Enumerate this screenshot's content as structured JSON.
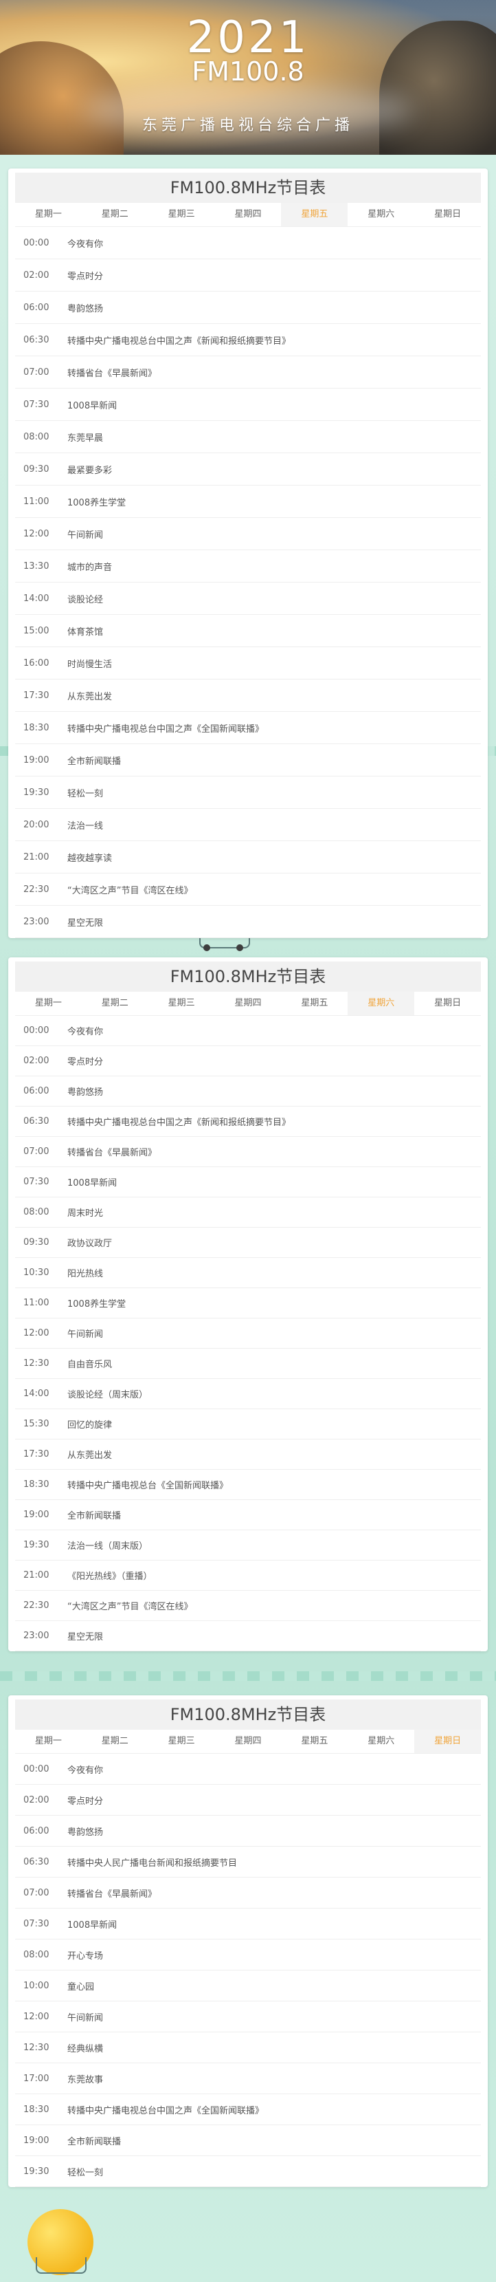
{
  "header": {
    "year": "2021",
    "frequency": "FM100.8",
    "station": "东莞广播电视台综合广播"
  },
  "schedules": [
    {
      "title": "FM100.8MHz节目表",
      "days": [
        "星期一",
        "星期二",
        "星期三",
        "星期四",
        "星期五",
        "星期六",
        "星期日"
      ],
      "active_day": 4,
      "rows": [
        {
          "time": "00:00",
          "name": "今夜有你"
        },
        {
          "time": "02:00",
          "name": "零点时分"
        },
        {
          "time": "06:00",
          "name": "粤韵悠扬"
        },
        {
          "time": "06:30",
          "name": "转播中央广播电视总台中国之声《新闻和报纸摘要节目》"
        },
        {
          "time": "07:00",
          "name": "转播省台《早晨新闻》"
        },
        {
          "time": "07:30",
          "name": "1008早新闻"
        },
        {
          "time": "08:00",
          "name": "东莞早晨"
        },
        {
          "time": "09:30",
          "name": "最紧要多彩"
        },
        {
          "time": "11:00",
          "name": "1008养生学堂"
        },
        {
          "time": "12:00",
          "name": "午间新闻"
        },
        {
          "time": "13:30",
          "name": "城市的声音"
        },
        {
          "time": "14:00",
          "name": "谈股论经"
        },
        {
          "time": "15:00",
          "name": "体育茶馆"
        },
        {
          "time": "16:00",
          "name": "时尚慢生活"
        },
        {
          "time": "17:30",
          "name": "从东莞出发"
        },
        {
          "time": "18:30",
          "name": "转播中央广播电视总台中国之声《全国新闻联播》"
        },
        {
          "time": "19:00",
          "name": "全市新闻联播"
        },
        {
          "time": "19:30",
          "name": "轻松一刻"
        },
        {
          "time": "20:00",
          "name": "法治一线"
        },
        {
          "time": "21:00",
          "name": "越夜越享读"
        },
        {
          "time": "22:30",
          "name": "“大湾区之声”节目《湾区在线》"
        },
        {
          "time": "23:00",
          "name": "星空无限"
        }
      ]
    },
    {
      "title": "FM100.8MHz节目表",
      "days": [
        "星期一",
        "星期二",
        "星期三",
        "星期四",
        "星期五",
        "星期六",
        "星期日"
      ],
      "active_day": 5,
      "rows": [
        {
          "time": "00:00",
          "name": "今夜有你"
        },
        {
          "time": "02:00",
          "name": "零点时分"
        },
        {
          "time": "06:00",
          "name": "粤韵悠扬"
        },
        {
          "time": "06:30",
          "name": "转播中央广播电视总台中国之声《新闻和报纸摘要节目》"
        },
        {
          "time": "07:00",
          "name": "转播省台《早晨新闻》"
        },
        {
          "time": "07:30",
          "name": "1008早新闻"
        },
        {
          "time": "08:00",
          "name": "周末时光"
        },
        {
          "time": "09:30",
          "name": "政协议政厅"
        },
        {
          "time": "10:30",
          "name": "阳光热线"
        },
        {
          "time": "11:00",
          "name": "1008养生学堂"
        },
        {
          "time": "12:00",
          "name": "午间新闻"
        },
        {
          "time": "12:30",
          "name": "自由音乐风"
        },
        {
          "time": "14:00",
          "name": "谈股论经（周末版）"
        },
        {
          "time": "15:30",
          "name": "回忆的旋律"
        },
        {
          "time": "17:30",
          "name": "从东莞出发"
        },
        {
          "time": "18:30",
          "name": "转播中央广播电视总台《全国新闻联播》"
        },
        {
          "time": "19:00",
          "name": "全市新闻联播"
        },
        {
          "time": "19:30",
          "name": "法治一线（周末版）"
        },
        {
          "time": "21:00",
          "name": "《阳光热线》（重播）"
        },
        {
          "time": "22:30",
          "name": "“大湾区之声”节目《湾区在线》"
        },
        {
          "time": "23:00",
          "name": "星空无限"
        }
      ]
    },
    {
      "title": "FM100.8MHz节目表",
      "days": [
        "星期一",
        "星期二",
        "星期三",
        "星期四",
        "星期五",
        "星期六",
        "星期日"
      ],
      "active_day": 6,
      "rows": [
        {
          "time": "00:00",
          "name": "今夜有你"
        },
        {
          "time": "02:00",
          "name": "零点时分"
        },
        {
          "time": "06:00",
          "name": "粤韵悠扬"
        },
        {
          "time": "06:30",
          "name": "转播中央人民广播电台新闻和报纸摘要节目"
        },
        {
          "time": "07:00",
          "name": "转播省台《早晨新闻》"
        },
        {
          "time": "07:30",
          "name": "1008早新闻"
        },
        {
          "time": "08:00",
          "name": "开心专场"
        },
        {
          "time": "10:00",
          "name": "童心园"
        },
        {
          "time": "12:00",
          "name": "午间新闻"
        },
        {
          "time": "12:30",
          "name": "经典纵横"
        },
        {
          "time": "17:00",
          "name": "东莞故事"
        },
        {
          "time": "18:30",
          "name": "转播中央广播电视总台中国之声《全国新闻联播》"
        },
        {
          "time": "19:00",
          "name": "全市新闻联播"
        },
        {
          "time": "19:30",
          "name": "轻松一刻"
        }
      ]
    }
  ]
}
